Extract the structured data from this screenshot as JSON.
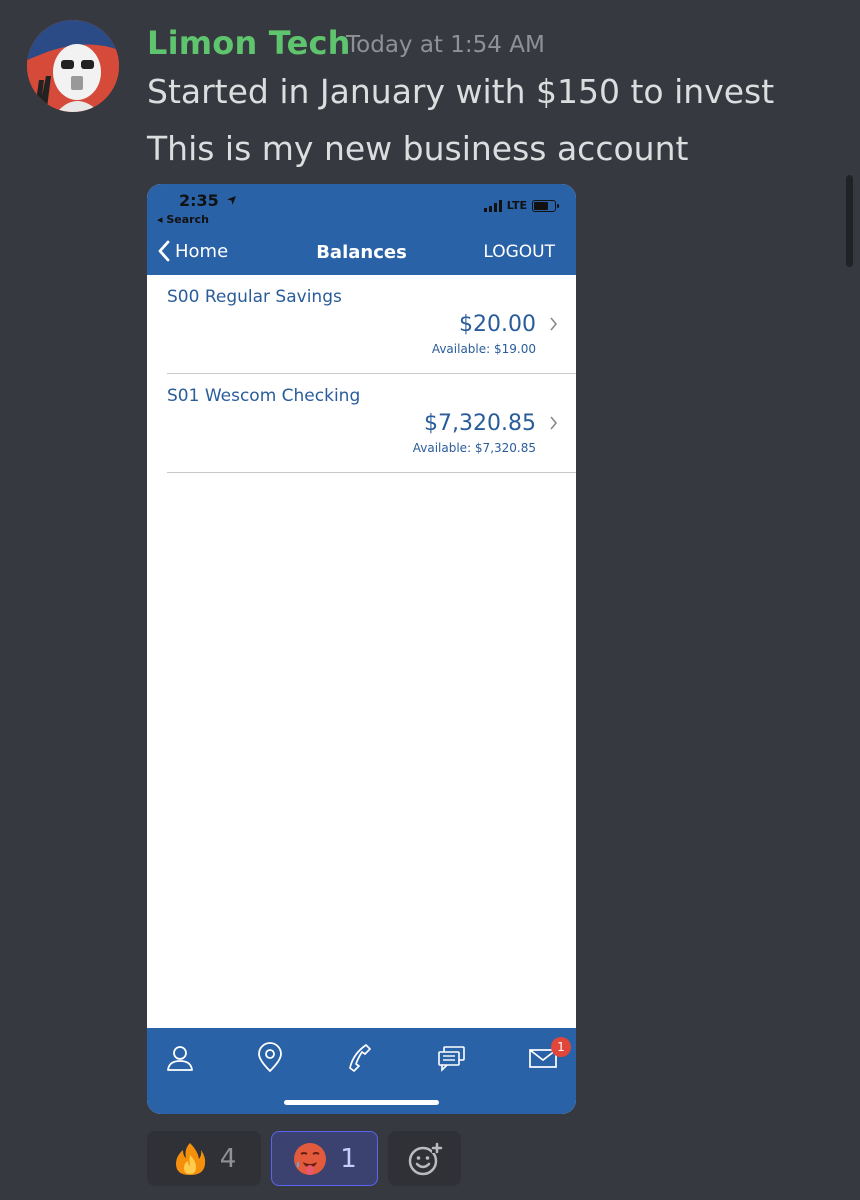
{
  "message": {
    "username": "Limon Tech",
    "timestamp": "Today at 1:54 AM",
    "lines": [
      "Started in January with $150 to invest",
      "This is my new business account"
    ]
  },
  "phone": {
    "status_bar": {
      "time": "2:35",
      "back_label": "◂ Search",
      "network": "LTE"
    },
    "nav": {
      "back_label": "Home",
      "title": "Balances",
      "logout_label": "LOGOUT"
    },
    "accounts": [
      {
        "name": "S00 Regular Savings",
        "balance": "$20.00",
        "available": "Available: $19.00"
      },
      {
        "name": "S01 Wescom Checking",
        "balance": "$7,320.85",
        "available": "Available: $7,320.85"
      }
    ],
    "tabbar": {
      "icons": [
        "person-icon",
        "location-pin-icon",
        "phone-icon",
        "chat-bubbles-icon",
        "mail-icon"
      ],
      "mail_badge": "1"
    }
  },
  "reactions": [
    {
      "emoji": "fire-emoji",
      "count": "4"
    },
    {
      "emoji": "hot-face-emoji",
      "count": "1"
    },
    {
      "emoji": "add-reaction-icon"
    }
  ],
  "colors": {
    "background": "#36393f",
    "username": "#5fc46e",
    "phone_blue": "#2a62a8",
    "account_text": "#2a5c9a"
  }
}
